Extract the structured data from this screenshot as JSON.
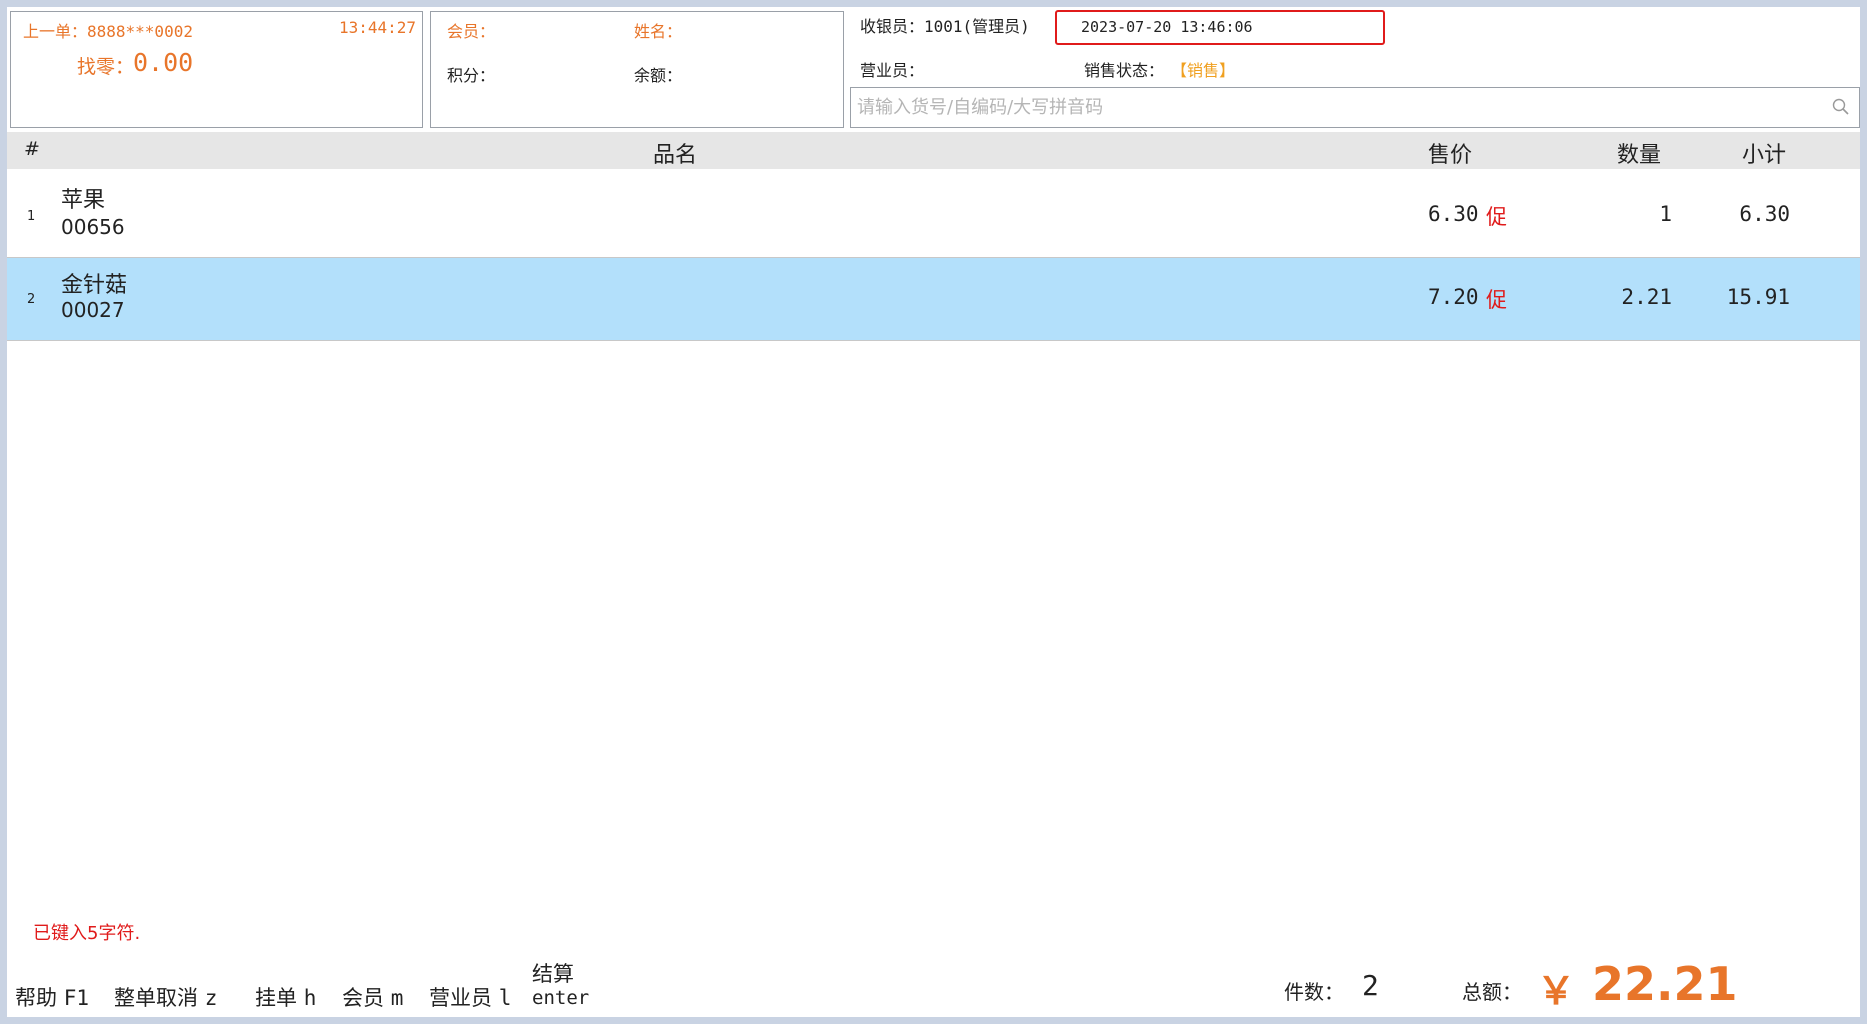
{
  "last_order": {
    "label": "上一单：8888***0002",
    "time": "13:44:27",
    "change_label": "找零：",
    "change_value": "0.00"
  },
  "member": {
    "member_label": "会员：",
    "name_label": "姓名：",
    "points_label": "积分：",
    "balance_label": "余额："
  },
  "cashier": {
    "cashier_label": "收银员：1001(管理员)",
    "datetime": "2023-07-20 13:46:06",
    "salesperson_label": "营业员：",
    "status_label": "销售状态：",
    "status_value": "【销售】"
  },
  "search": {
    "placeholder": "请输入货号/自编码/大写拼音码",
    "icon": "search-icon"
  },
  "table": {
    "headers": {
      "index": "#",
      "name": "品名",
      "price": "售价",
      "qty": "数量",
      "subtotal": "小计"
    },
    "rows": [
      {
        "index": "1",
        "name": "苹果",
        "code": "00656",
        "price": "6.30",
        "promo": "促",
        "qty": "1",
        "subtotal": "6.30"
      },
      {
        "index": "2",
        "name": "金针菇",
        "code": "00027",
        "price": "7.20",
        "promo": "促",
        "qty": "2.21",
        "subtotal": "15.91"
      }
    ],
    "selected_row": 2
  },
  "status_message": "已键入5字符.",
  "shortcuts": [
    {
      "label": "帮助",
      "key": "F1"
    },
    {
      "label": "整单取消",
      "key": "z"
    },
    {
      "label": "挂单",
      "key": "h"
    },
    {
      "label": "会员",
      "key": "m"
    },
    {
      "label": "营业员",
      "key": "l"
    },
    {
      "label": "结算",
      "key": "enter"
    }
  ],
  "summary": {
    "count_label": "件数：",
    "count_value": "2",
    "total_label": "总额：",
    "currency": "￥",
    "total_value": "22.21"
  },
  "colors": {
    "accent": "#e8752a",
    "promo": "#e01b1b",
    "selected_row": "#b3e0fb",
    "header_bg": "#e6e6e6"
  }
}
